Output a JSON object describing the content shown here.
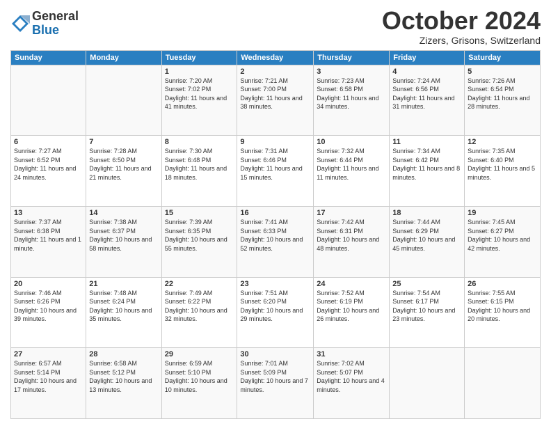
{
  "logo": {
    "general": "General",
    "blue": "Blue"
  },
  "header": {
    "month": "October 2024",
    "location": "Zizers, Grisons, Switzerland"
  },
  "days_of_week": [
    "Sunday",
    "Monday",
    "Tuesday",
    "Wednesday",
    "Thursday",
    "Friday",
    "Saturday"
  ],
  "weeks": [
    [
      {
        "day": "",
        "info": ""
      },
      {
        "day": "",
        "info": ""
      },
      {
        "day": "1",
        "info": "Sunrise: 7:20 AM\nSunset: 7:02 PM\nDaylight: 11 hours and 41 minutes."
      },
      {
        "day": "2",
        "info": "Sunrise: 7:21 AM\nSunset: 7:00 PM\nDaylight: 11 hours and 38 minutes."
      },
      {
        "day": "3",
        "info": "Sunrise: 7:23 AM\nSunset: 6:58 PM\nDaylight: 11 hours and 34 minutes."
      },
      {
        "day": "4",
        "info": "Sunrise: 7:24 AM\nSunset: 6:56 PM\nDaylight: 11 hours and 31 minutes."
      },
      {
        "day": "5",
        "info": "Sunrise: 7:26 AM\nSunset: 6:54 PM\nDaylight: 11 hours and 28 minutes."
      }
    ],
    [
      {
        "day": "6",
        "info": "Sunrise: 7:27 AM\nSunset: 6:52 PM\nDaylight: 11 hours and 24 minutes."
      },
      {
        "day": "7",
        "info": "Sunrise: 7:28 AM\nSunset: 6:50 PM\nDaylight: 11 hours and 21 minutes."
      },
      {
        "day": "8",
        "info": "Sunrise: 7:30 AM\nSunset: 6:48 PM\nDaylight: 11 hours and 18 minutes."
      },
      {
        "day": "9",
        "info": "Sunrise: 7:31 AM\nSunset: 6:46 PM\nDaylight: 11 hours and 15 minutes."
      },
      {
        "day": "10",
        "info": "Sunrise: 7:32 AM\nSunset: 6:44 PM\nDaylight: 11 hours and 11 minutes."
      },
      {
        "day": "11",
        "info": "Sunrise: 7:34 AM\nSunset: 6:42 PM\nDaylight: 11 hours and 8 minutes."
      },
      {
        "day": "12",
        "info": "Sunrise: 7:35 AM\nSunset: 6:40 PM\nDaylight: 11 hours and 5 minutes."
      }
    ],
    [
      {
        "day": "13",
        "info": "Sunrise: 7:37 AM\nSunset: 6:38 PM\nDaylight: 11 hours and 1 minute."
      },
      {
        "day": "14",
        "info": "Sunrise: 7:38 AM\nSunset: 6:37 PM\nDaylight: 10 hours and 58 minutes."
      },
      {
        "day": "15",
        "info": "Sunrise: 7:39 AM\nSunset: 6:35 PM\nDaylight: 10 hours and 55 minutes."
      },
      {
        "day": "16",
        "info": "Sunrise: 7:41 AM\nSunset: 6:33 PM\nDaylight: 10 hours and 52 minutes."
      },
      {
        "day": "17",
        "info": "Sunrise: 7:42 AM\nSunset: 6:31 PM\nDaylight: 10 hours and 48 minutes."
      },
      {
        "day": "18",
        "info": "Sunrise: 7:44 AM\nSunset: 6:29 PM\nDaylight: 10 hours and 45 minutes."
      },
      {
        "day": "19",
        "info": "Sunrise: 7:45 AM\nSunset: 6:27 PM\nDaylight: 10 hours and 42 minutes."
      }
    ],
    [
      {
        "day": "20",
        "info": "Sunrise: 7:46 AM\nSunset: 6:26 PM\nDaylight: 10 hours and 39 minutes."
      },
      {
        "day": "21",
        "info": "Sunrise: 7:48 AM\nSunset: 6:24 PM\nDaylight: 10 hours and 35 minutes."
      },
      {
        "day": "22",
        "info": "Sunrise: 7:49 AM\nSunset: 6:22 PM\nDaylight: 10 hours and 32 minutes."
      },
      {
        "day": "23",
        "info": "Sunrise: 7:51 AM\nSunset: 6:20 PM\nDaylight: 10 hours and 29 minutes."
      },
      {
        "day": "24",
        "info": "Sunrise: 7:52 AM\nSunset: 6:19 PM\nDaylight: 10 hours and 26 minutes."
      },
      {
        "day": "25",
        "info": "Sunrise: 7:54 AM\nSunset: 6:17 PM\nDaylight: 10 hours and 23 minutes."
      },
      {
        "day": "26",
        "info": "Sunrise: 7:55 AM\nSunset: 6:15 PM\nDaylight: 10 hours and 20 minutes."
      }
    ],
    [
      {
        "day": "27",
        "info": "Sunrise: 6:57 AM\nSunset: 5:14 PM\nDaylight: 10 hours and 17 minutes."
      },
      {
        "day": "28",
        "info": "Sunrise: 6:58 AM\nSunset: 5:12 PM\nDaylight: 10 hours and 13 minutes."
      },
      {
        "day": "29",
        "info": "Sunrise: 6:59 AM\nSunset: 5:10 PM\nDaylight: 10 hours and 10 minutes."
      },
      {
        "day": "30",
        "info": "Sunrise: 7:01 AM\nSunset: 5:09 PM\nDaylight: 10 hours and 7 minutes."
      },
      {
        "day": "31",
        "info": "Sunrise: 7:02 AM\nSunset: 5:07 PM\nDaylight: 10 hours and 4 minutes."
      },
      {
        "day": "",
        "info": ""
      },
      {
        "day": "",
        "info": ""
      }
    ]
  ]
}
